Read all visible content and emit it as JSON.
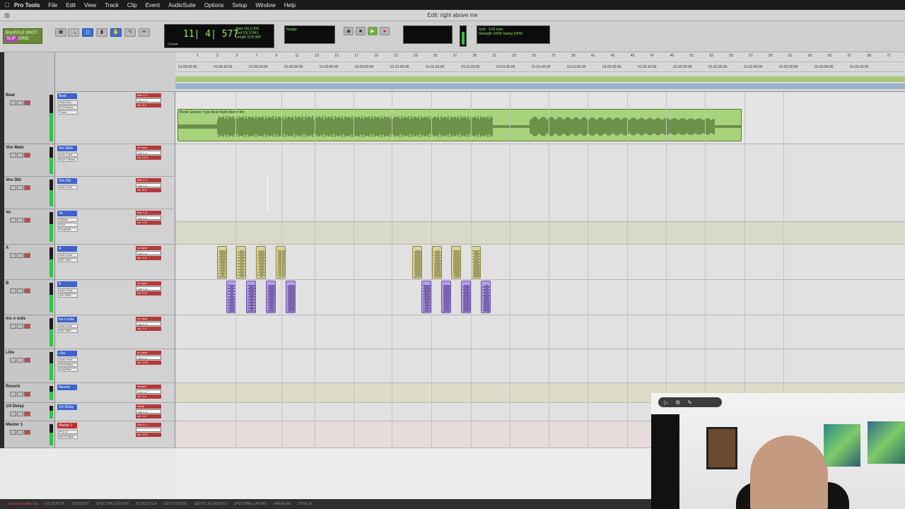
{
  "menubar": {
    "app_name": "Pro Tools",
    "items": [
      "File",
      "Edit",
      "View",
      "Track",
      "Clip",
      "Event",
      "AudioSuite",
      "Options",
      "Setup",
      "Window",
      "Help"
    ]
  },
  "window": {
    "title": "Edit: right above me"
  },
  "toolbar": {
    "mode_labels": [
      "SHUFFLE",
      "SPOT",
      "SLIP",
      "GRID"
    ],
    "counter_main": "11| 4| 577",
    "counter_side": [
      "Start",
      "End",
      "Length"
    ],
    "counter_side_values": [
      "10| 1| 841",
      "10| 1| 841",
      "0| 0| 000"
    ],
    "cursor_label": "Cursor",
    "nudge_label": "Nudge",
    "grid_label": "Grid",
    "grid_value": "1/16 note",
    "strength_label": "Strength",
    "strength_value": "100%",
    "swing_label": "Swing",
    "swing_value": "100%"
  },
  "tracks": [
    {
      "name": "Beat",
      "color": "#3d62c9",
      "inserts": [
        "Auto-Key",
        "DG3-Mono",
        "Trans"
      ],
      "io": [
        "Bus 1-2",
        "Out 1-2",
        "vol -0.0"
      ]
    },
    {
      "name": "Vox Main",
      "color": "#3d62c9",
      "inserts": [
        "Auto-Tune",
        "EQ3 7-Band"
      ],
      "io": [
        "no input",
        "Out 1-2",
        "vol -10.0"
      ]
    },
    {
      "name": "Vox Dbl",
      "color": "#3d62c9",
      "inserts": [
        "Auto-Tune"
      ],
      "io": [
        "Bus 1-2",
        "Out 1-2",
        "vol -6.0"
      ]
    },
    {
      "name": "Vo",
      "color": "#3d62c9",
      "inserts": [
        "RBass",
        "DG3",
        "FreqShift"
      ],
      "io": [
        "Bus 7-8",
        "Out 1-2",
        "vol +0.0"
      ]
    },
    {
      "name": "A",
      "color": "#3d62c9",
      "inserts": [
        "Auto-Tune",
        "API 2500"
      ],
      "io": [
        "no input",
        "Out 1-2",
        "vol -7.4"
      ]
    },
    {
      "name": "B",
      "color": "#3d62c9",
      "inserts": [
        "Auto-Tune",
        "API 2500"
      ],
      "io": [
        "no input",
        "Out 1-2",
        "vol +0.0"
      ]
    },
    {
      "name": "Ins n outs",
      "color": "#3d62c9",
      "inserts": [
        "Auto-Tune",
        "API 2500"
      ],
      "io": [
        "no input",
        "Out 1-2",
        "vol -7.4"
      ]
    },
    {
      "name": "Libs",
      "color": "#3d62c9",
      "inserts": [
        "Auto-Tune",
        "DG3-Mono",
        "AutoFilter"
      ],
      "io": [
        "no input",
        "Out 1-2",
        "vol -14.8"
      ]
    },
    {
      "name": "Reverb",
      "color": "#3d62c9",
      "inserts": [],
      "io": [
        "Reverb",
        "Out 1-2",
        "vol -0.0"
      ]
    },
    {
      "name": "1/4 Delay",
      "color": "#3d62c9",
      "inserts": [],
      "io": [
        "Delay",
        "Out 1-2",
        "vol -0.0"
      ]
    },
    {
      "name": "Master 1",
      "color": "#c12d2d",
      "inserts": [
        "Pro-L2",
        "MLTR Mast"
      ],
      "io": [
        "Out 1-2",
        "",
        "vol +0.0"
      ]
    }
  ],
  "clips": {
    "beat_clip_name": "Bodie Sample Type Beat Right Above Me"
  },
  "rulers": {
    "bars": [
      "1",
      "3",
      "5",
      "7",
      "9",
      "11",
      "13",
      "15",
      "17",
      "19",
      "21",
      "23",
      "25",
      "27",
      "29",
      "31",
      "33",
      "35",
      "37",
      "39",
      "41",
      "43",
      "45",
      "47",
      "49",
      "51",
      "53",
      "55",
      "57",
      "59",
      "61",
      "63",
      "65",
      "67",
      "69",
      "71",
      "73"
    ],
    "timecodes": [
      "01:00:00:00",
      "01:00:10:00",
      "01:00:20:00",
      "01:00:30:00",
      "01:00:40:00",
      "01:00:50:00",
      "01:01:00:00",
      "01:01:10:00",
      "01:01:20:00",
      "01:01:30:00",
      "01:01:40:00",
      "01:01:50:00",
      "01:02:00:00",
      "01:02:10:00",
      "01:02:20:00",
      "01:02:30:00",
      "01:02:40:00",
      "01:02:50:00",
      "01:03:00:00",
      "01:03:10:00"
    ]
  },
  "bottombar": {
    "items": [
      "EQ EDITOR",
      "SYNSHOT",
      "SPECTRAL EDITOR",
      "ACOUSTICA",
      "EDIT FOLDER",
      "SEPTIC ELEMENTS",
      "SPECTRAL LAYERS",
      "WAVELAB",
      "SYNC AI"
    ],
    "status": "cursor modifier key"
  },
  "colors": {
    "beat_clip": "#a7d37c",
    "lead_clips": "#d8d59b",
    "rec_clips": "#b59ee6",
    "counter_text": "#8fe85c"
  }
}
